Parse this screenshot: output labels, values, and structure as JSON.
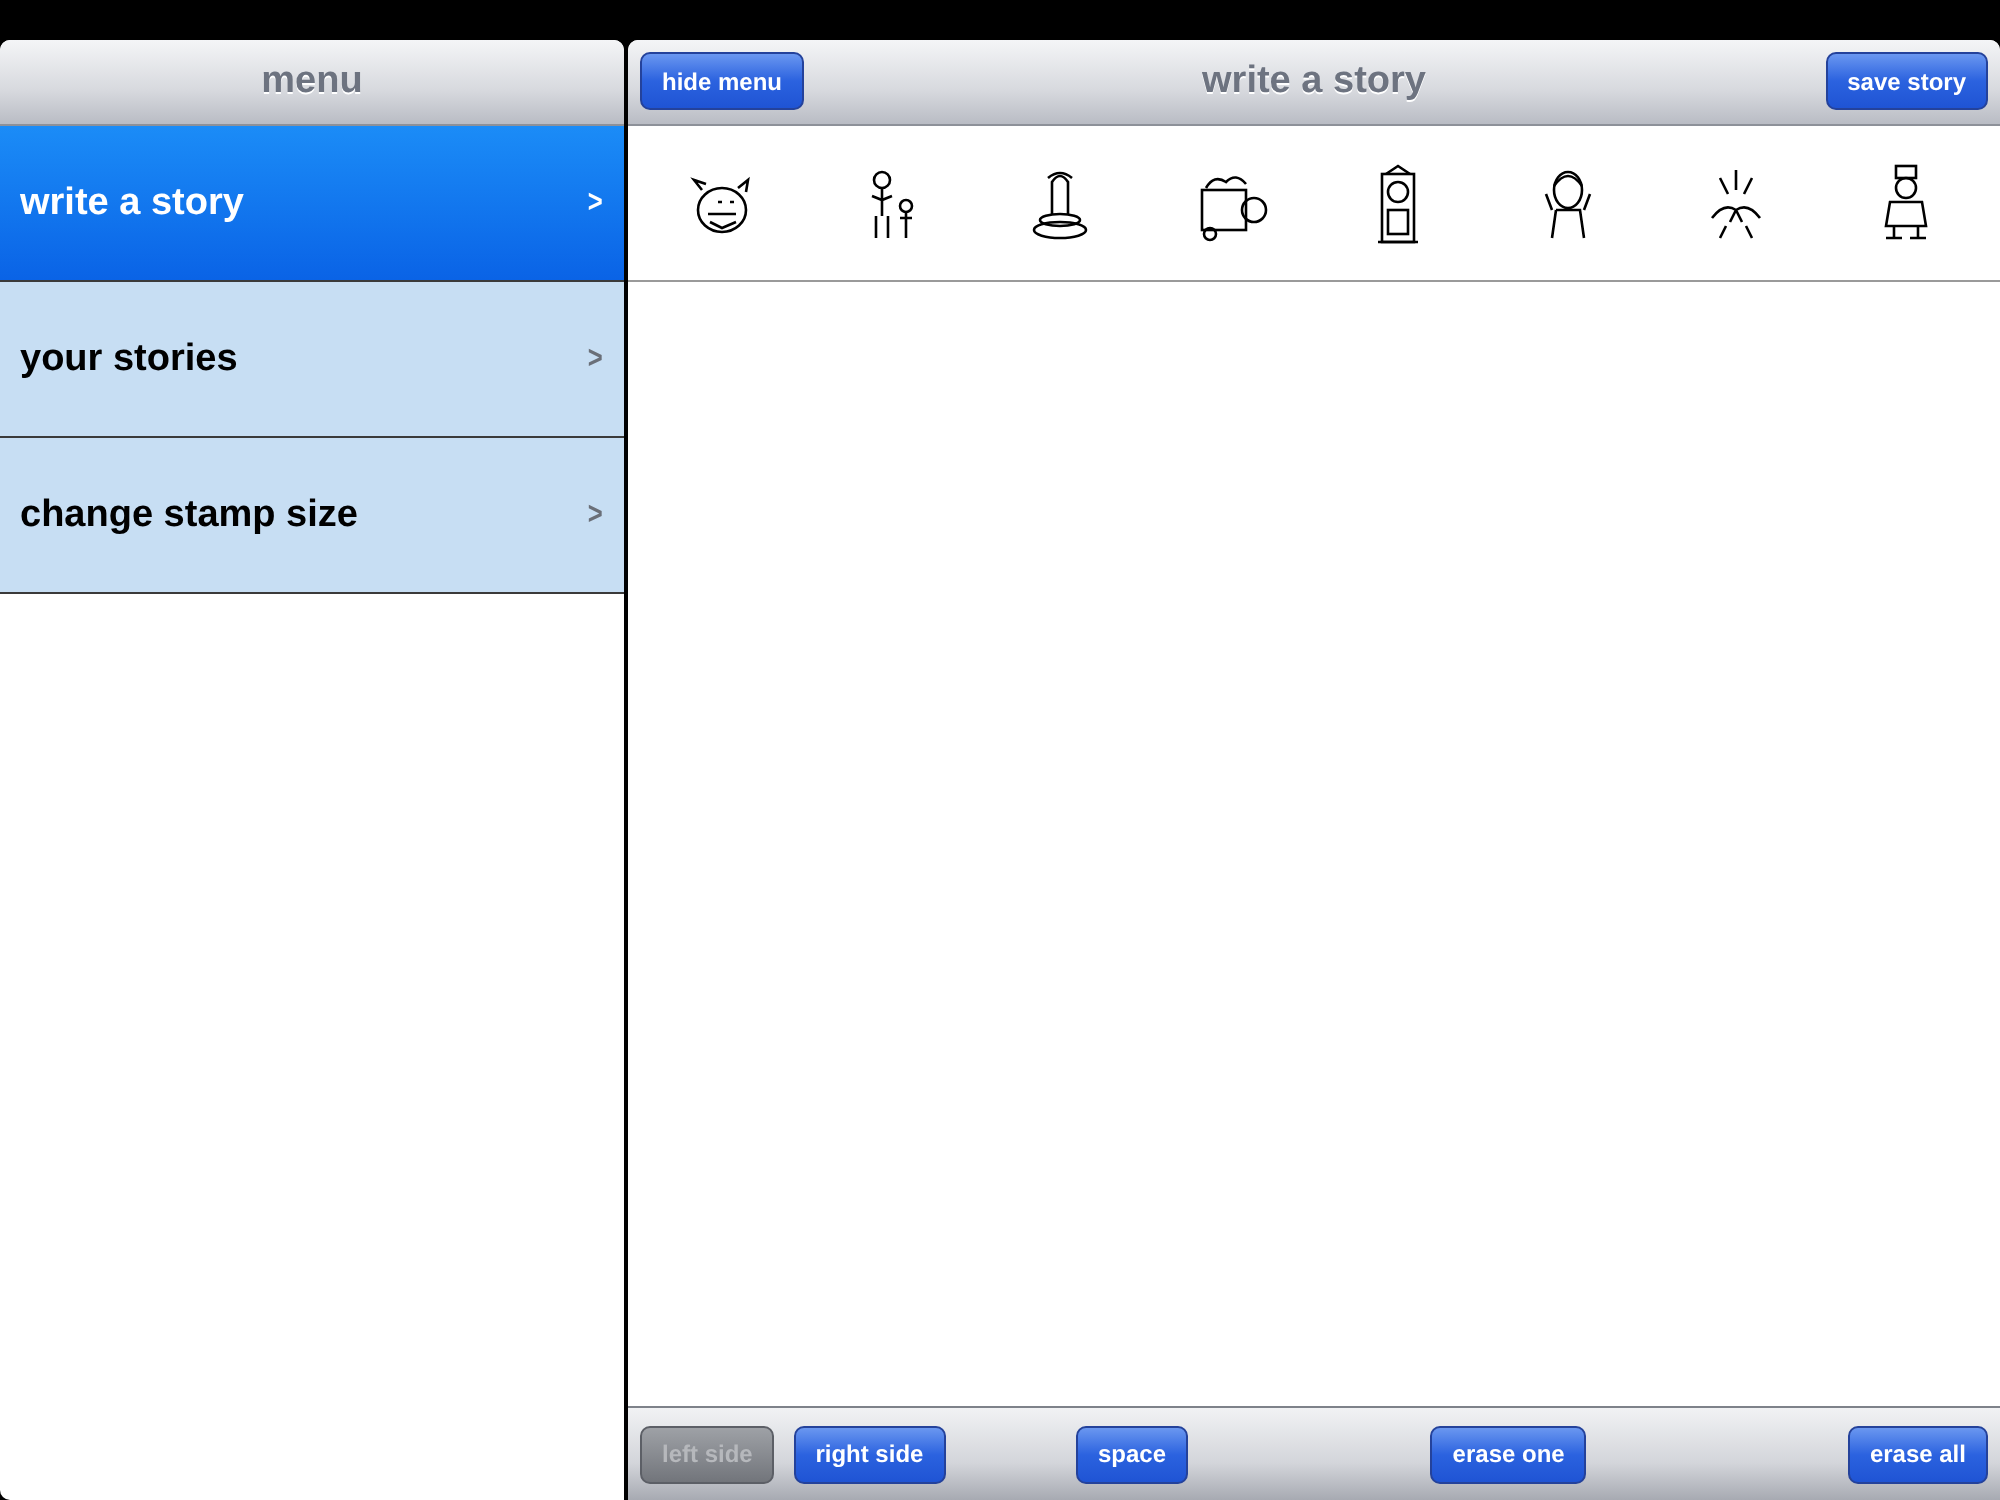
{
  "menu": {
    "title": "menu",
    "items": [
      {
        "label": "write a story",
        "selected": true,
        "chevron": ">"
      },
      {
        "label": "your stories",
        "selected": false,
        "chevron": ">"
      },
      {
        "label": "change stamp size",
        "selected": false,
        "chevron": ">"
      }
    ]
  },
  "editor": {
    "title": "write a story",
    "left_button": "hide menu",
    "right_button": "save story",
    "toolbar": [
      {
        "label": "left side",
        "disabled": true
      },
      {
        "label": "right side",
        "disabled": false
      },
      {
        "label": "space",
        "disabled": false
      },
      {
        "label": "erase one",
        "disabled": false
      },
      {
        "label": "erase all",
        "disabled": false
      }
    ]
  }
}
